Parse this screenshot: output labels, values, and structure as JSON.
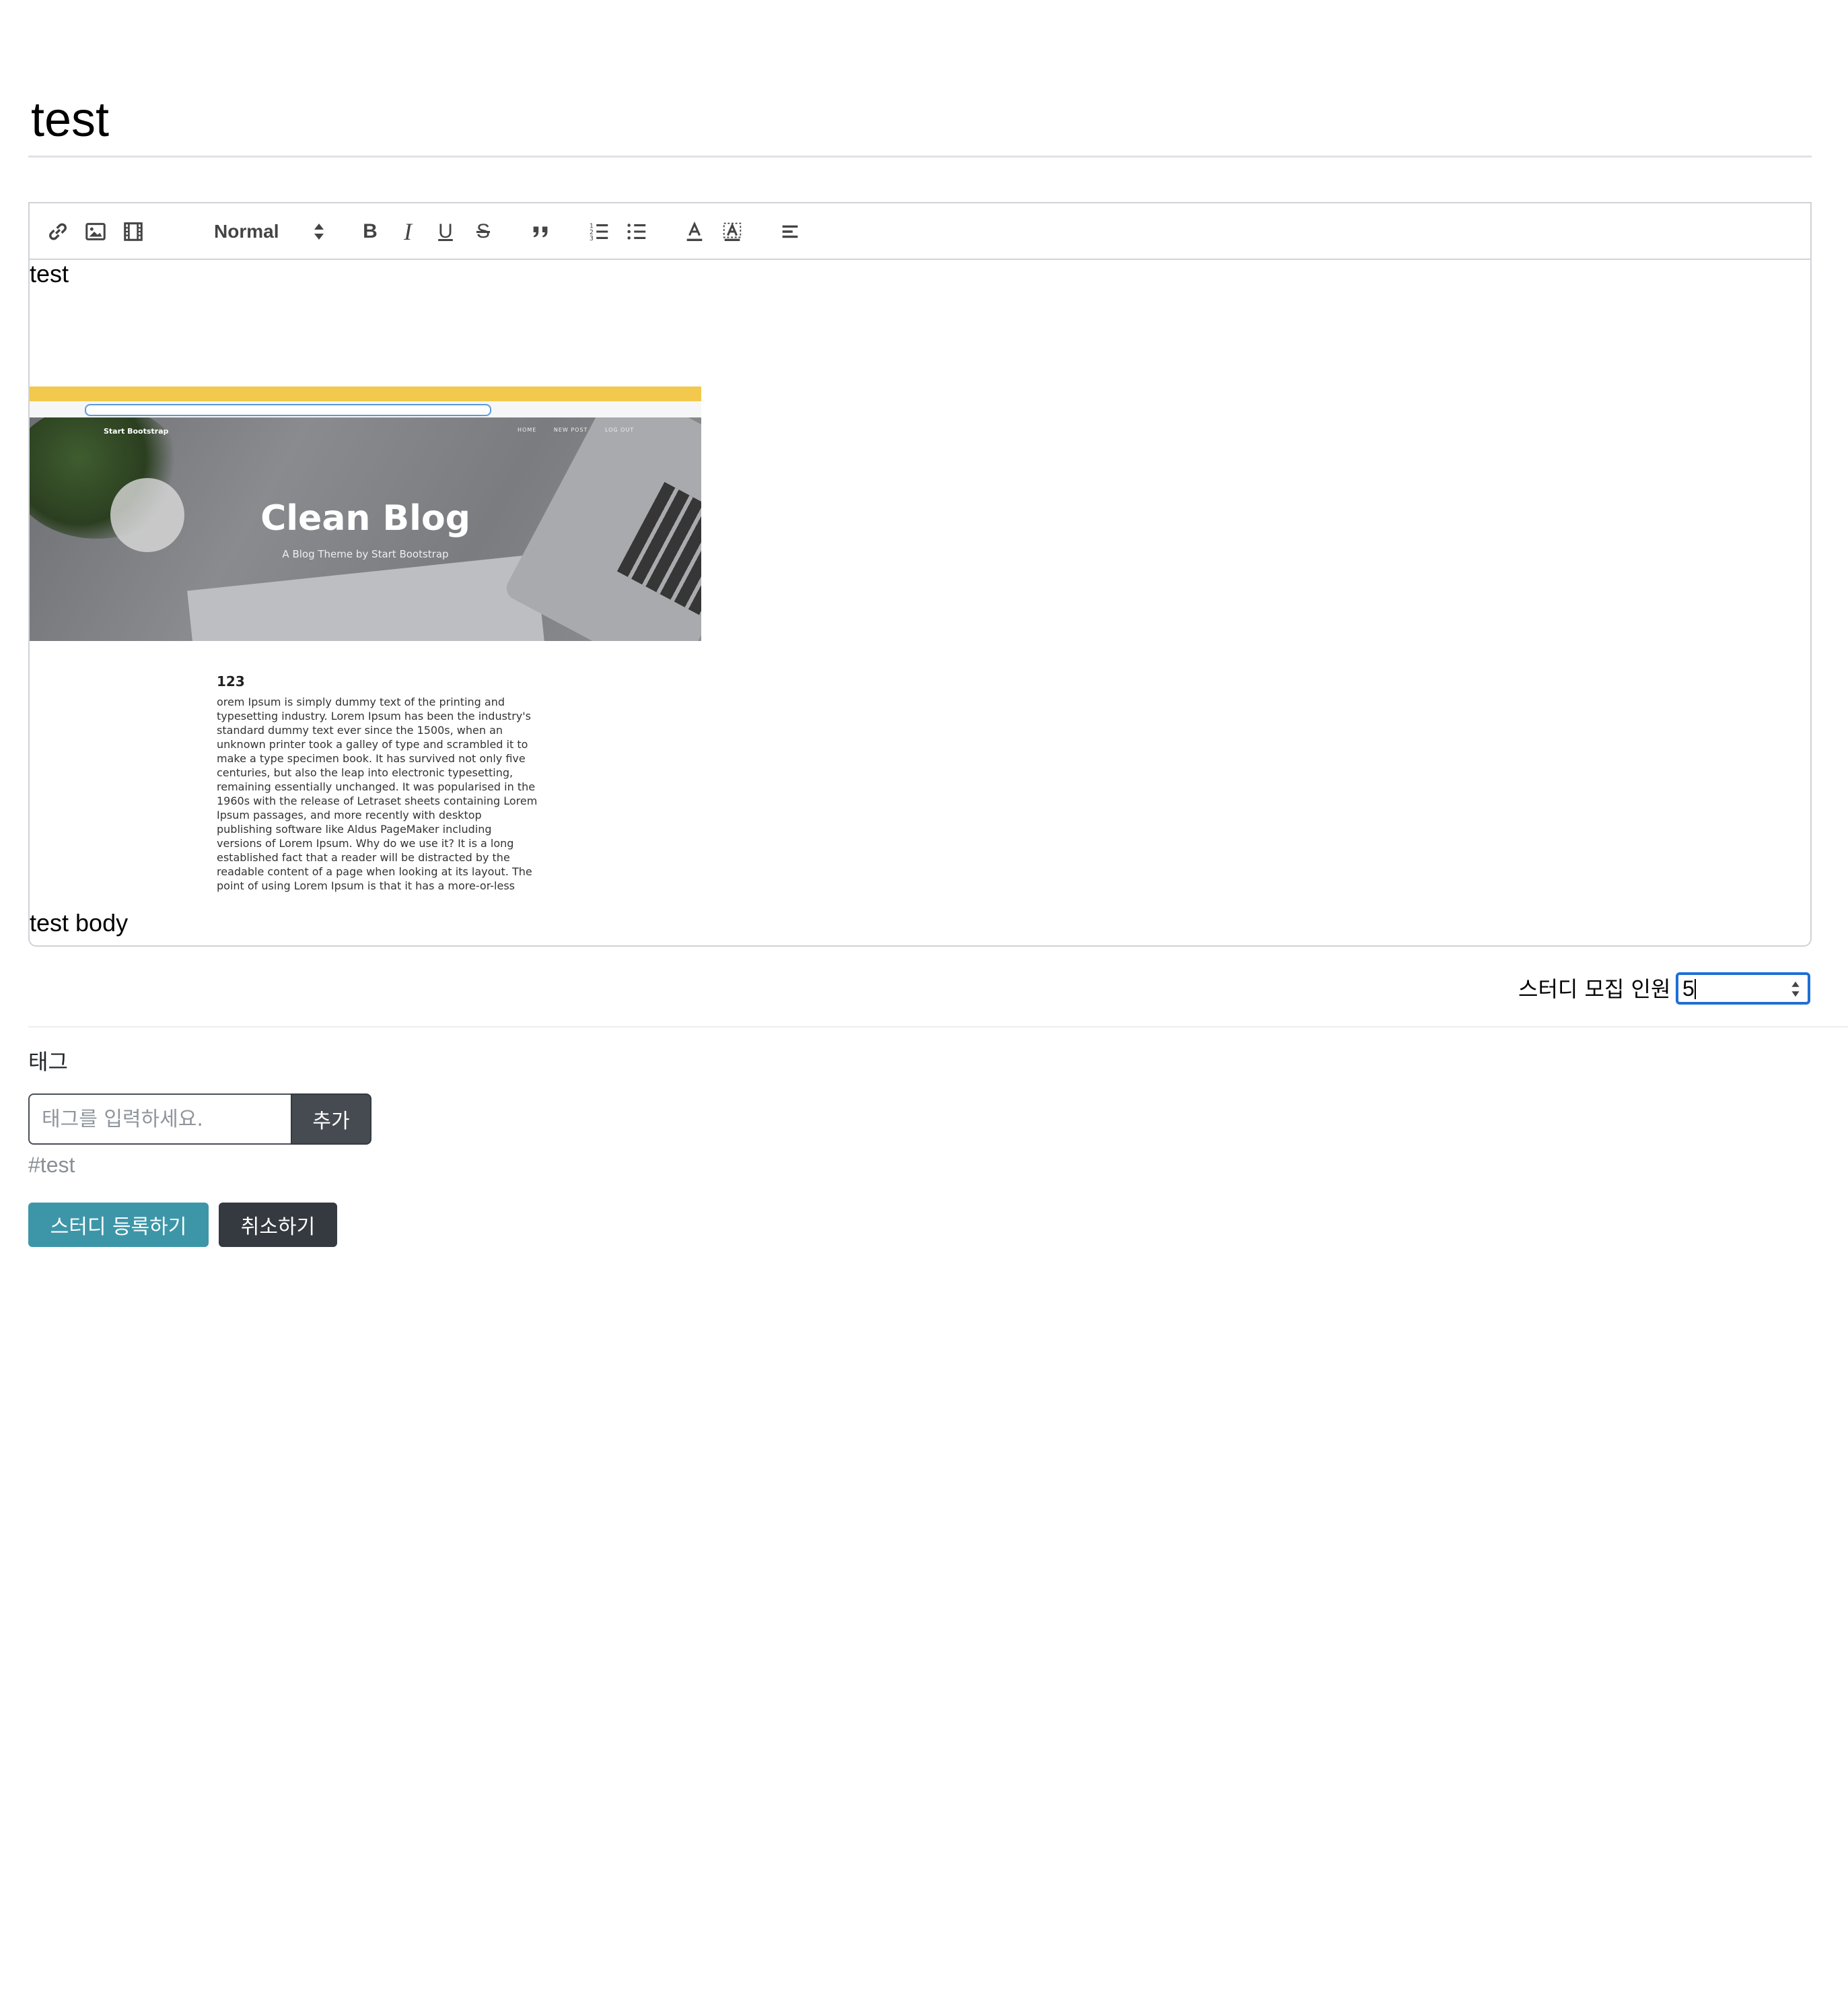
{
  "title_value": "test",
  "editor": {
    "header_select": "Normal",
    "toolbar": {
      "bold": "B",
      "italic": "I",
      "underline": "U",
      "strike": "S"
    },
    "paragraphs": [
      "test",
      "test body"
    ],
    "embedded_image": {
      "brand": "Start Bootstrap",
      "nav": [
        "HOME",
        "NEW POST",
        "LOG OUT"
      ],
      "hero_title": "Clean Blog",
      "hero_subtitle": "A Blog Theme by Start Bootstrap",
      "post_heading": "123",
      "post_body": "orem Ipsum is simply dummy text of the printing and typesetting industry. Lorem Ipsum has been the industry's standard dummy text ever since the 1500s, when an unknown printer took a galley of type and scrambled it to make a type specimen book. It has survived not only five centuries, but also the leap into electronic typesetting, remaining essentially unchanged. It was popularised in the 1960s with the release of Letraset sheets containing Lorem Ipsum passages, and more recently with desktop publishing software like Aldus PageMaker including versions of Lorem Ipsum. Why do we use it? It is a long established fact that a reader will be distracted by the readable content of a page when looking at its layout. The point of using Lorem Ipsum is that it has a more-or-less"
    }
  },
  "recruit": {
    "label": "스터디 모집 인원",
    "value": "5"
  },
  "tags": {
    "label": "태그",
    "placeholder": "태그를 입력하세요.",
    "add_button": "추가",
    "items": [
      "#test"
    ]
  },
  "actions": {
    "submit": "스터디 등록하기",
    "cancel": "취소하기"
  },
  "colors": {
    "submit_bg": "#3d96a8",
    "cancel_bg": "#343a40",
    "focus_border": "#1f6fd6"
  }
}
